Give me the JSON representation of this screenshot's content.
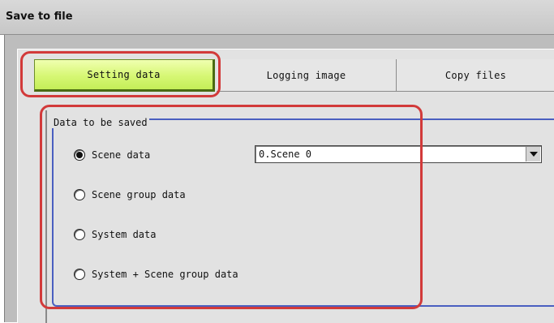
{
  "window": {
    "title": "Save to file"
  },
  "tabs": [
    {
      "label": "Setting data",
      "active": true
    },
    {
      "label": "Logging image",
      "active": false
    },
    {
      "label": "Copy files",
      "active": false
    }
  ],
  "group": {
    "legend": "Data to be saved",
    "options": [
      {
        "label": "Scene data",
        "checked": true
      },
      {
        "label": "Scene group data",
        "checked": false
      },
      {
        "label": "System data",
        "checked": false
      },
      {
        "label": "System + Scene group data",
        "checked": false
      }
    ],
    "scene_select": {
      "value": "0.Scene 0"
    }
  },
  "colors": {
    "active_tab": "#d6f774",
    "highlight": "#d23a3a",
    "group_border": "#4a5fc0"
  }
}
